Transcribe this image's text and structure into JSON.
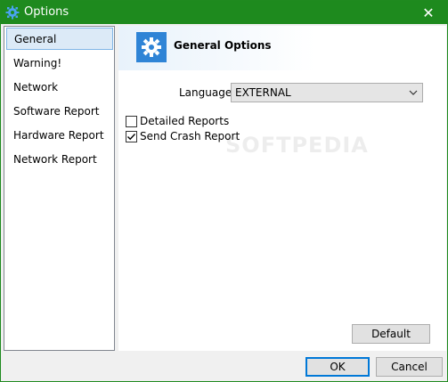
{
  "window": {
    "title": "Options",
    "app_icon": "gear-icon",
    "close_glyph": "✕"
  },
  "sidebar": {
    "items": [
      {
        "label": "General",
        "selected": true
      },
      {
        "label": "Warning!",
        "selected": false
      },
      {
        "label": "Network",
        "selected": false
      },
      {
        "label": "Software Report",
        "selected": false
      },
      {
        "label": "Hardware Report",
        "selected": false
      },
      {
        "label": "Network Report",
        "selected": false
      }
    ]
  },
  "main": {
    "header_title": "General Options",
    "header_icon": "gear-icon",
    "language_label": "Language",
    "language_value": "EXTERNAL",
    "checkboxes": [
      {
        "label": "Detailed Reports",
        "checked": false
      },
      {
        "label": "Send Crash Report",
        "checked": true
      }
    ],
    "watermark": "SOFTPEDIA"
  },
  "buttons": {
    "default": "Default",
    "ok": "OK",
    "cancel": "Cancel"
  },
  "colors": {
    "titlebar": "#1e8a1e",
    "accent": "#2f84d6",
    "selection": "#dceaf7"
  }
}
